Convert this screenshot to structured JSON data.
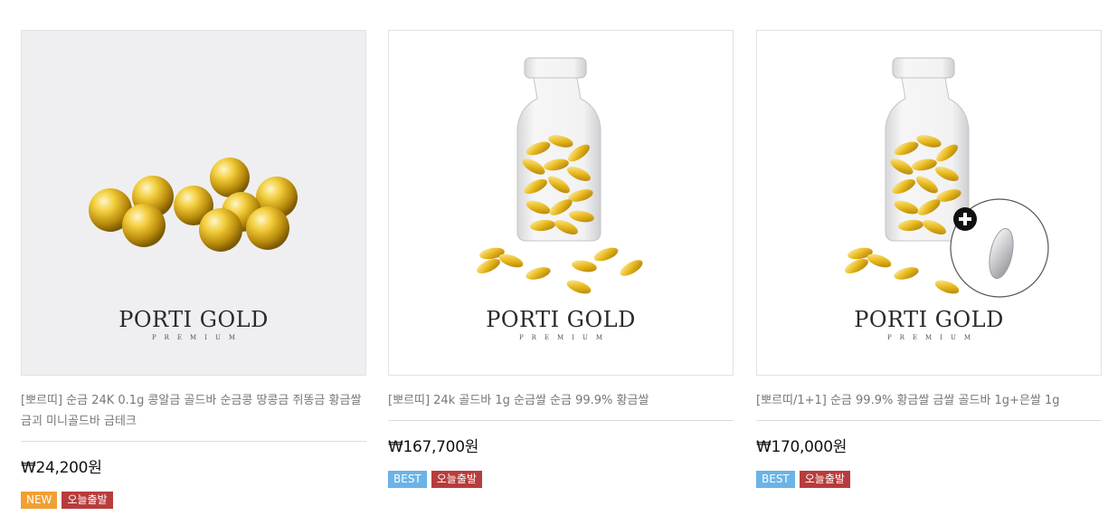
{
  "products": [
    {
      "brand": "PORTI GOLD",
      "brand_sub": "PREMIUM",
      "name": "[뽀르띠] 순금 24K 0.1g 콩알금 골드바 순금콩 땅콩금 쥐똥금 황금쌀 금괴 미니골드바 금테크",
      "price": "₩24,200원",
      "badges": [
        {
          "label": "NEW",
          "type": "new"
        },
        {
          "label": "오늘출발",
          "type": "today"
        }
      ],
      "image": "gold-beads"
    },
    {
      "brand": "PORTI GOLD",
      "brand_sub": "PREMIUM",
      "name": "[뽀르띠] 24k 골드바 1g 순금쌀 순금 99.9% 황금쌀",
      "price": "₩167,700원",
      "badges": [
        {
          "label": "BEST",
          "type": "best"
        },
        {
          "label": "오늘출발",
          "type": "today"
        }
      ],
      "image": "gold-rice-bottle"
    },
    {
      "brand": "PORTI GOLD",
      "brand_sub": "PREMIUM",
      "name": "[뽀르띠/1+1] 순금 99.9% 황금쌀 금쌀 골드바 1g+은쌀 1g",
      "price": "₩170,000원",
      "badges": [
        {
          "label": "BEST",
          "type": "best"
        },
        {
          "label": "오늘출발",
          "type": "today"
        }
      ],
      "image": "gold-rice-bottle-plus-silver"
    }
  ],
  "colors": {
    "new": "#f0a034",
    "best": "#6bb3e8",
    "today": "#b83c3c",
    "gold": "#e0b21c"
  }
}
